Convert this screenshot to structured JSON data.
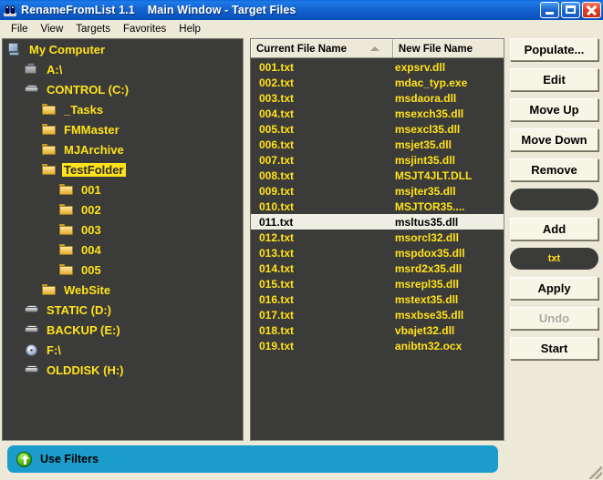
{
  "titlebar": {
    "app_icon": "binoculars-icon",
    "app_title": "RenameFromList 1.1",
    "window_subtitle": "Main Window - Target Files",
    "minimize": "minimize-icon",
    "maximize": "maximize-icon",
    "close": "close-icon"
  },
  "menubar": {
    "items": [
      {
        "label": "File"
      },
      {
        "label": "View"
      },
      {
        "label": "Targets"
      },
      {
        "label": "Favorites"
      },
      {
        "label": "Help"
      }
    ]
  },
  "tree": {
    "items": [
      {
        "label": "My Computer",
        "icon": "computer-icon",
        "indent": 0,
        "selected": false
      },
      {
        "label": "A:\\",
        "icon": "floppy-icon",
        "indent": 1,
        "selected": false
      },
      {
        "label": "CONTROL (C:)",
        "icon": "harddisk-icon",
        "indent": 1,
        "selected": false
      },
      {
        "label": "_Tasks",
        "icon": "folder-icon",
        "indent": 2,
        "selected": false
      },
      {
        "label": "FMMaster",
        "icon": "folder-icon",
        "indent": 2,
        "selected": false
      },
      {
        "label": "MJArchive",
        "icon": "folder-icon",
        "indent": 2,
        "selected": false
      },
      {
        "label": "TestFolder",
        "icon": "folder-icon",
        "indent": 2,
        "selected": true
      },
      {
        "label": "001",
        "icon": "folder-icon",
        "indent": 3,
        "selected": false
      },
      {
        "label": "002",
        "icon": "folder-icon",
        "indent": 3,
        "selected": false
      },
      {
        "label": "003",
        "icon": "folder-icon",
        "indent": 3,
        "selected": false
      },
      {
        "label": "004",
        "icon": "folder-icon",
        "indent": 3,
        "selected": false
      },
      {
        "label": "005",
        "icon": "folder-icon",
        "indent": 3,
        "selected": false
      },
      {
        "label": "WebSite",
        "icon": "folder-icon",
        "indent": 2,
        "selected": false
      },
      {
        "label": "STATIC (D:)",
        "icon": "harddisk-icon",
        "indent": 1,
        "selected": false
      },
      {
        "label": "BACKUP (E:)",
        "icon": "harddisk-icon",
        "indent": 1,
        "selected": false
      },
      {
        "label": "F:\\",
        "icon": "cd-icon",
        "indent": 1,
        "selected": false
      },
      {
        "label": "OLDDISK (H:)",
        "icon": "harddisk-icon",
        "indent": 1,
        "selected": false
      }
    ]
  },
  "filelist": {
    "columns": [
      {
        "label": "Current File Name",
        "sorted": true,
        "sort_dir": "asc"
      },
      {
        "label": "New File Name",
        "sorted": false
      }
    ],
    "rows": [
      {
        "current": "001.txt",
        "new": "expsrv.dll",
        "selected": false
      },
      {
        "current": "002.txt",
        "new": "mdac_typ.exe",
        "selected": false
      },
      {
        "current": "003.txt",
        "new": "msdaora.dll",
        "selected": false
      },
      {
        "current": "004.txt",
        "new": "msexch35.dll",
        "selected": false
      },
      {
        "current": "005.txt",
        "new": "msexcl35.dll",
        "selected": false
      },
      {
        "current": "006.txt",
        "new": "msjet35.dll",
        "selected": false
      },
      {
        "current": "007.txt",
        "new": "msjint35.dll",
        "selected": false
      },
      {
        "current": "008.txt",
        "new": "MSJT4JLT.DLL",
        "selected": false
      },
      {
        "current": "009.txt",
        "new": "msjter35.dll",
        "selected": false
      },
      {
        "current": "010.txt",
        "new": "MSJTOR35....",
        "selected": false
      },
      {
        "current": "011.txt",
        "new": "msltus35.dll",
        "selected": true
      },
      {
        "current": "012.txt",
        "new": "msorcl32.dll",
        "selected": false
      },
      {
        "current": "013.txt",
        "new": "mspdox35.dll",
        "selected": false
      },
      {
        "current": "014.txt",
        "new": "msrd2x35.dll",
        "selected": false
      },
      {
        "current": "015.txt",
        "new": "msrepl35.dll",
        "selected": false
      },
      {
        "current": "016.txt",
        "new": "mstext35.dll",
        "selected": false
      },
      {
        "current": "017.txt",
        "new": "msxbse35.dll",
        "selected": false
      },
      {
        "current": "018.txt",
        "new": "vbajet32.dll",
        "selected": false
      },
      {
        "current": "019.txt",
        "new": "anibtn32.ocx",
        "selected": false
      }
    ]
  },
  "actions": {
    "populate": "Populate...",
    "edit": "Edit",
    "move_up": "Move Up",
    "move_down": "Move Down",
    "remove": "Remove",
    "extension_pill_top": "",
    "add": "Add",
    "extension_pill": "txt",
    "apply": "Apply",
    "undo": "Undo",
    "start": "Start"
  },
  "filters": {
    "icon": "green-up-arrow-icon",
    "label": "Use Filters"
  },
  "colors": {
    "panel_background": "#3b3b39",
    "list_text": "#ffe21a",
    "selection_background": "#efeee2",
    "window_chrome": "#ece9d8",
    "titlebar_blue": "#1464d0",
    "filters_blue": "#1b9ccb"
  }
}
